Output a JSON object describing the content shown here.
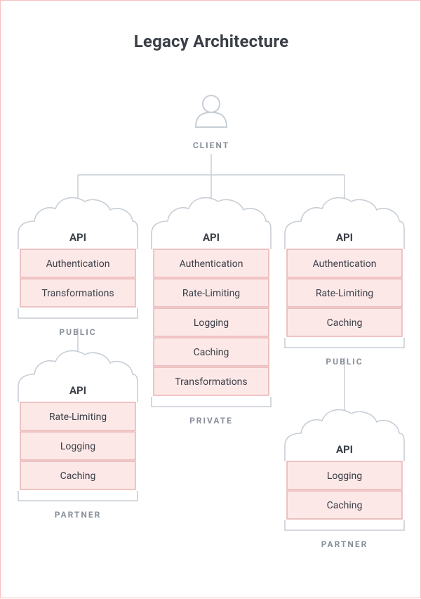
{
  "title": "Legacy Architecture",
  "client_label": "CLIENT",
  "api_label": "API",
  "columns": {
    "left_top": {
      "group_label": "PUBLIC",
      "cells": [
        "Authentication",
        "Transformations"
      ]
    },
    "center": {
      "group_label": "PRIVATE",
      "cells": [
        "Authentication",
        "Rate-Limiting",
        "Logging",
        "Caching",
        "Transformations"
      ]
    },
    "right_top": {
      "group_label": "PUBLIC",
      "cells": [
        "Authentication",
        "Rate-Limiting",
        "Caching"
      ]
    },
    "left_bot": {
      "group_label": "PARTNER",
      "cells": [
        "Rate-Limiting",
        "Logging",
        "Caching"
      ]
    },
    "right_bot": {
      "group_label": "PARTNER",
      "cells": [
        "Logging",
        "Caching"
      ]
    }
  },
  "colors": {
    "stroke": "#c8ced6",
    "cell_fill": "#fde8e8",
    "cell_stroke": "#e7a9a9",
    "title": "#3a3f47",
    "muted": "#888f99"
  }
}
